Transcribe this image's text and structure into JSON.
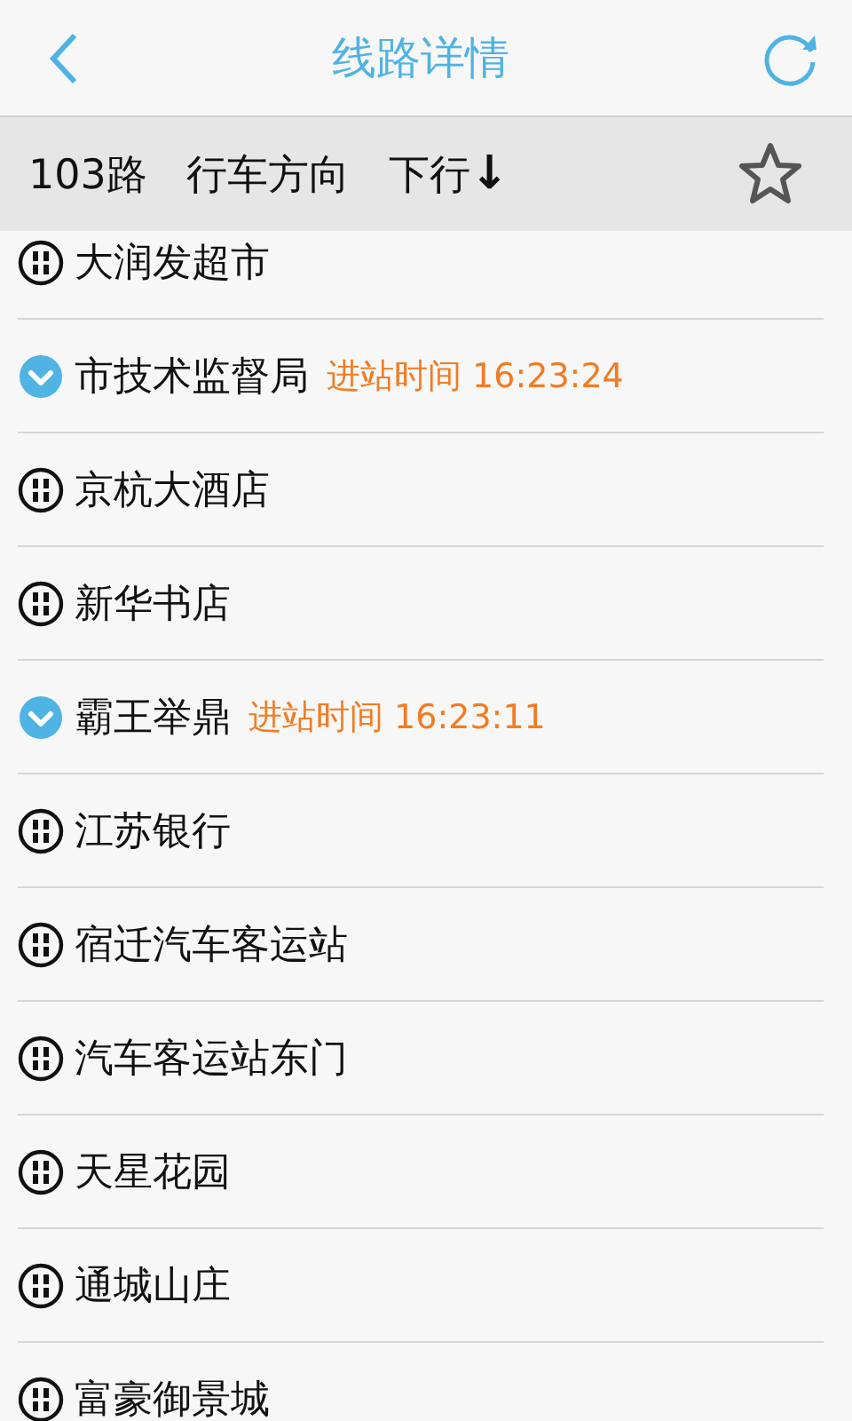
{
  "nav_bar": {
    "title": "线路详情"
  },
  "route_bar": {
    "route": "103路",
    "direction_label": "行车方向",
    "direction": "下行",
    "direction_arrow": "↓",
    "favorite": false
  },
  "stops": [
    {
      "name": "大润发超市",
      "kind": "stop"
    },
    {
      "name": "市技术监督局",
      "kind": "bus",
      "arrival": "进站时间 16:23:24"
    },
    {
      "name": "京杭大酒店",
      "kind": "stop"
    },
    {
      "name": "新华书店",
      "kind": "stop"
    },
    {
      "name": "霸王举鼎",
      "kind": "bus",
      "arrival": "进站时间 16:23:11"
    },
    {
      "name": "江苏银行",
      "kind": "stop"
    },
    {
      "name": "宿迁汽车客运站",
      "kind": "stop"
    },
    {
      "name": "汽车客运站东门",
      "kind": "stop"
    },
    {
      "name": "天星花园",
      "kind": "stop"
    },
    {
      "name": "通城山庄",
      "kind": "stop"
    },
    {
      "name": "富豪御景城",
      "kind": "stop"
    }
  ]
}
